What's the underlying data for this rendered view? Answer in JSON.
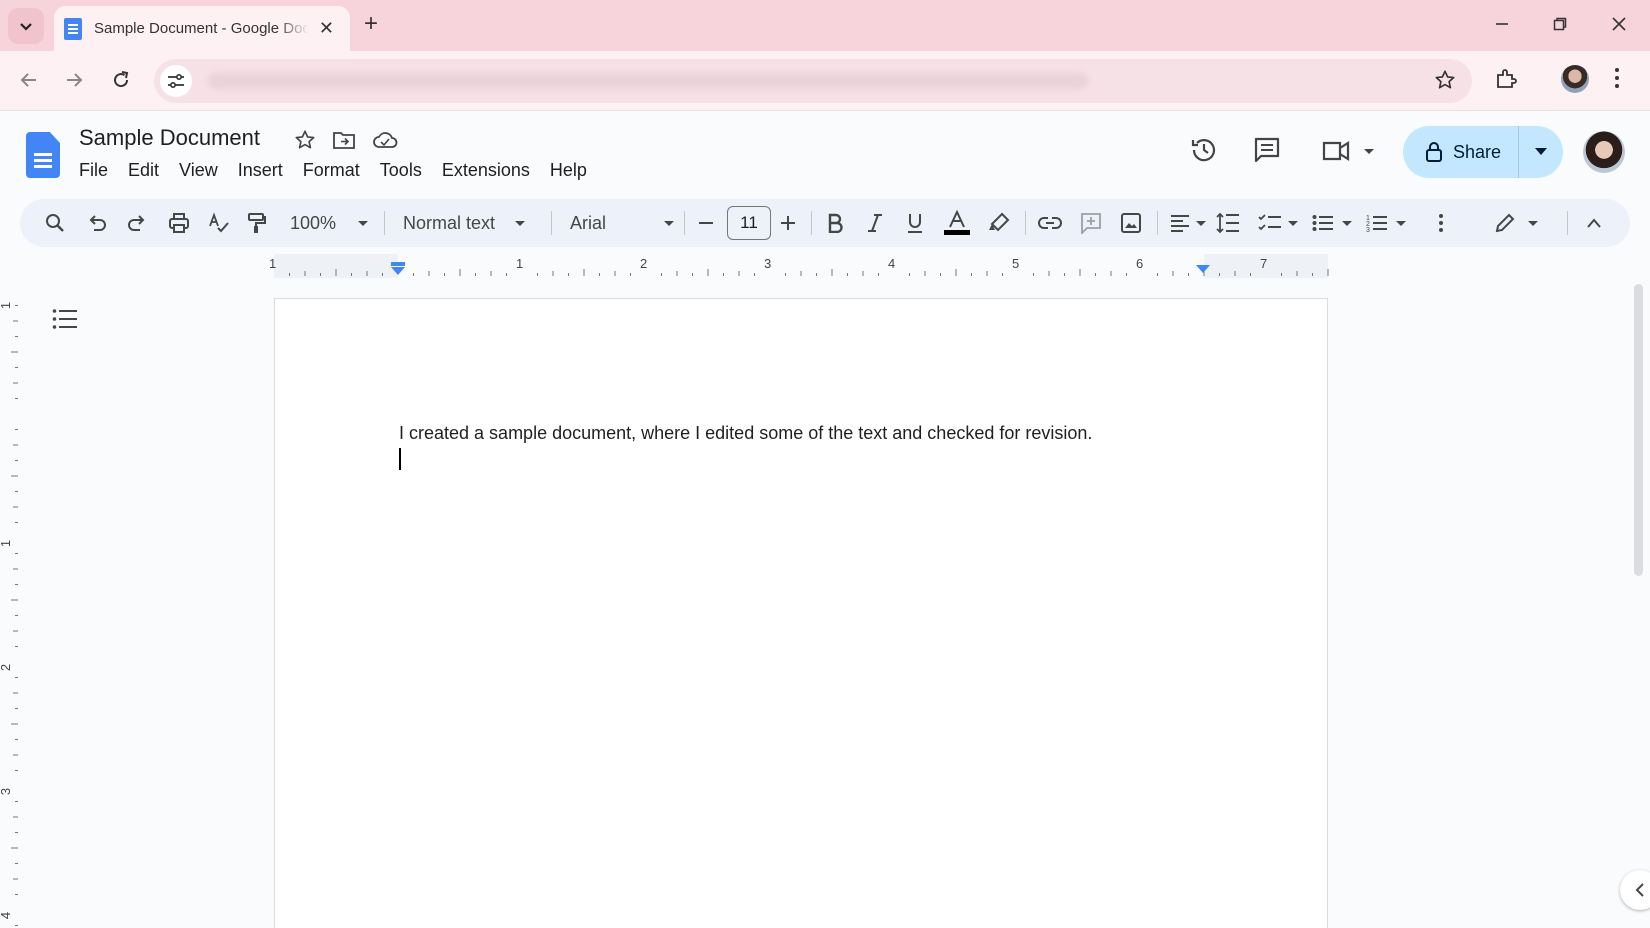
{
  "browser": {
    "tab_title": "Sample Document - Google Docs",
    "new_tab_label": "+"
  },
  "doc": {
    "title": "Sample Document",
    "menus": [
      "File",
      "Edit",
      "View",
      "Insert",
      "Format",
      "Tools",
      "Extensions",
      "Help"
    ],
    "share_label": "Share",
    "body_text": "I created a sample document, where I edited some of the text and checked for revision."
  },
  "toolbar": {
    "zoom": "100%",
    "style": "Normal text",
    "font": "Arial",
    "font_size": "11"
  },
  "ruler": {
    "horizontal_marks": [
      "1",
      "1",
      "2",
      "3",
      "4",
      "5",
      "6",
      "7"
    ],
    "vertical_marks": [
      "1",
      "1",
      "2",
      "3",
      "4"
    ]
  },
  "colors": {
    "tabstrip": "#f7d4dc",
    "share_button": "#c2e7ff",
    "docs_blue": "#4285f4"
  },
  "icons": [
    "search-icon",
    "undo-icon",
    "redo-icon",
    "print-icon",
    "spellcheck-icon",
    "paint-format-icon",
    "bold-icon",
    "italic-icon",
    "underline-icon",
    "text-color-icon",
    "highlight-icon",
    "link-icon",
    "comment-add-icon",
    "image-icon",
    "align-icon",
    "line-spacing-icon",
    "checklist-icon",
    "bullet-list-icon",
    "numbered-list-icon",
    "more-icon",
    "edit-mode-icon",
    "collapse-icon"
  ]
}
